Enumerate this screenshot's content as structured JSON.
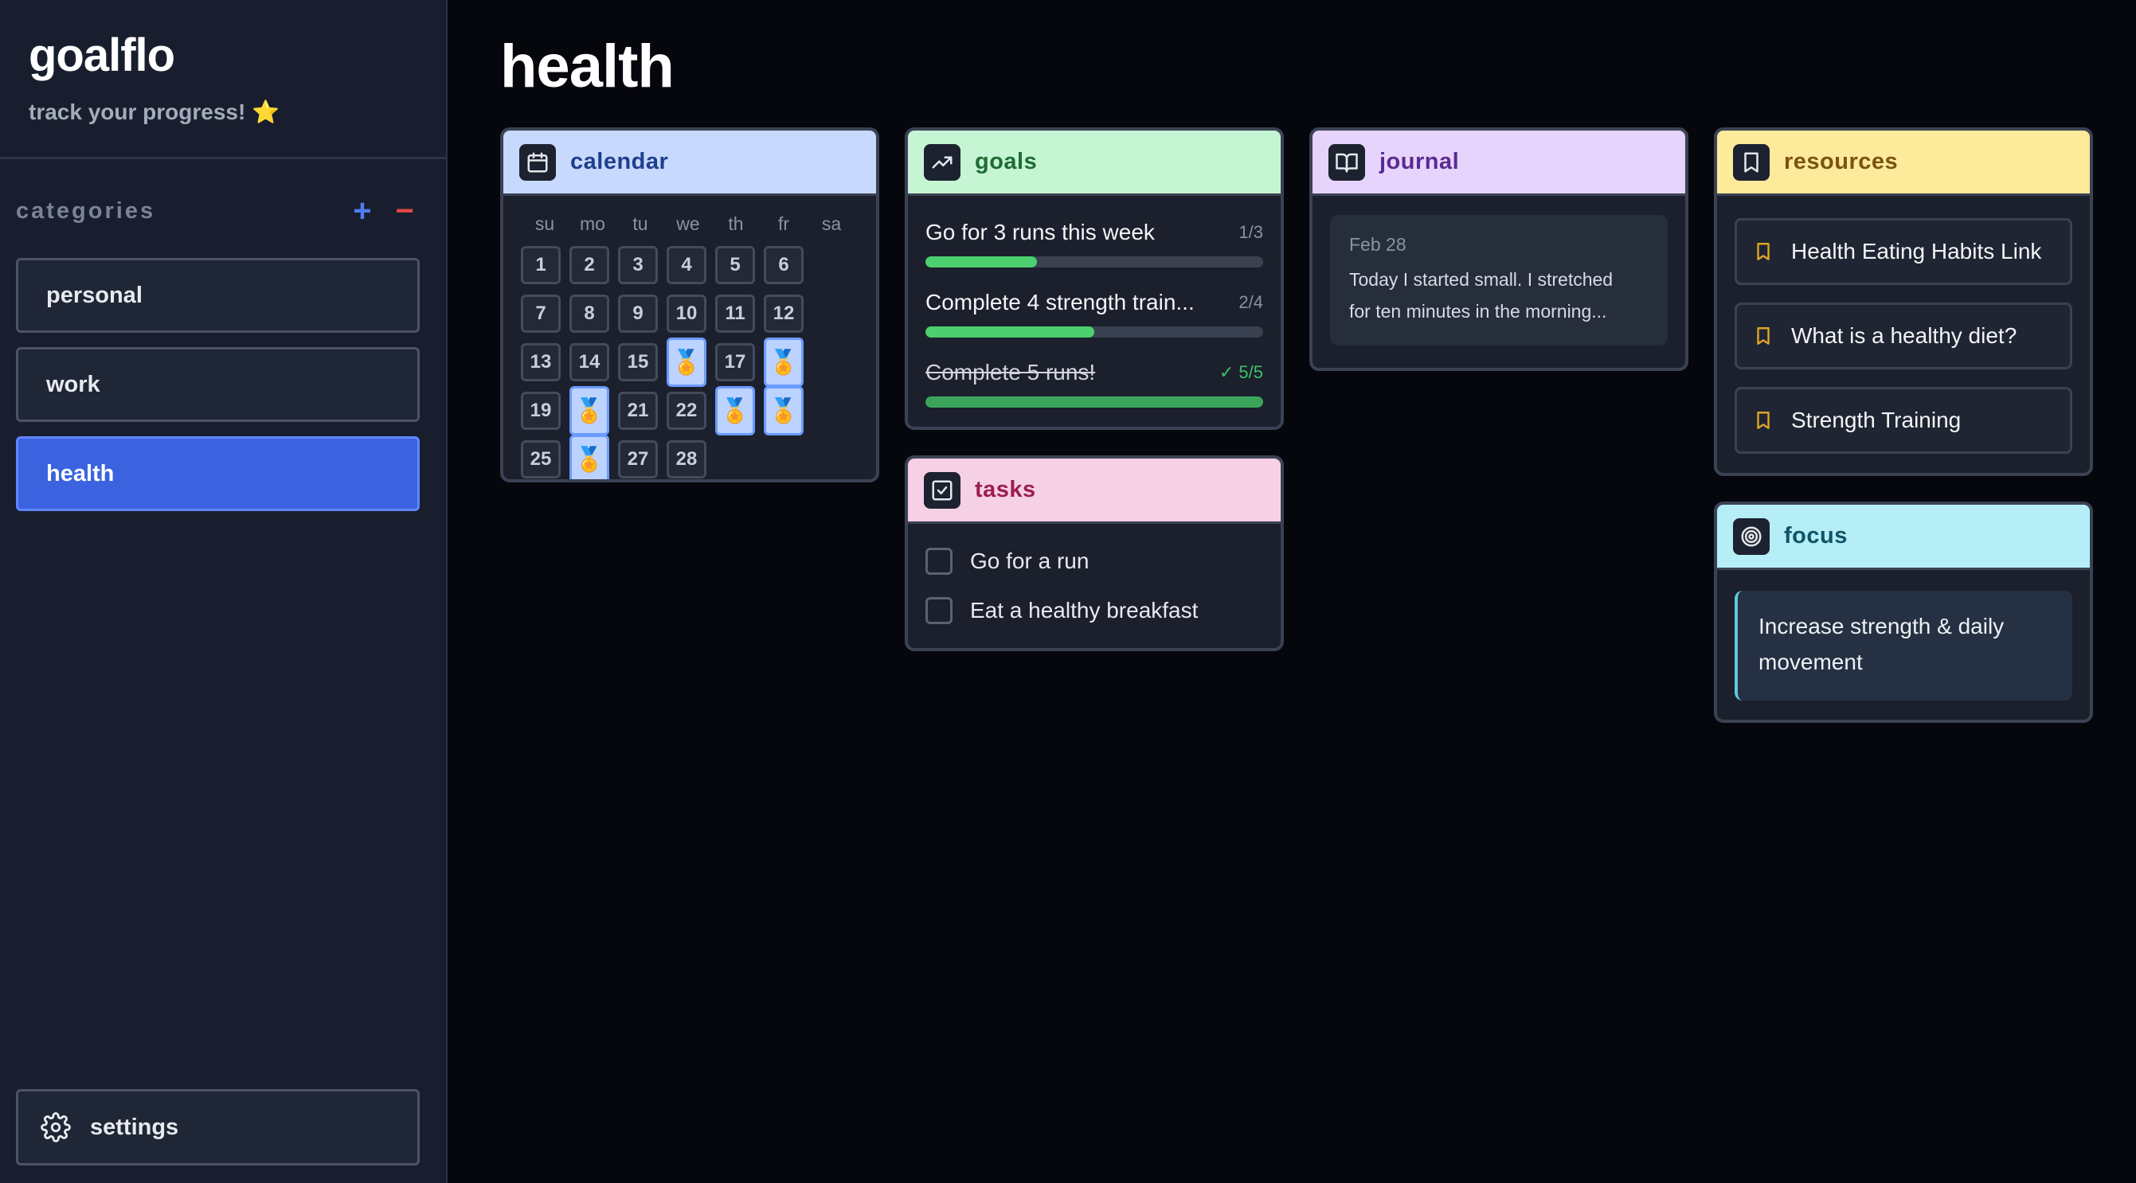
{
  "app": {
    "title": "goalflo",
    "subtitle": "track your progress!",
    "subtitle_emoji": "⭐"
  },
  "sidebar": {
    "categories_label": "categories",
    "add_symbol": "+",
    "remove_symbol": "−",
    "items": [
      {
        "label": "personal",
        "active": false
      },
      {
        "label": "work",
        "active": false
      },
      {
        "label": "health",
        "active": true
      }
    ],
    "settings_label": "settings"
  },
  "page": {
    "title": "health"
  },
  "colors": {
    "calendar": "#c7d9fc",
    "goals": "#c6f5d3",
    "journal": "#e6d4fc",
    "resources": "#fdea9a",
    "tasks": "#f6d0e5",
    "focus": "#b6eef8",
    "accent": "#3b63df"
  },
  "calendar": {
    "title": "calendar",
    "weekdays": [
      "su",
      "mo",
      "tu",
      "we",
      "th",
      "fr",
      "sa"
    ],
    "days": [
      "1",
      "2",
      "3",
      "4",
      "5",
      "6",
      "7",
      "8",
      "9",
      "10",
      "11",
      "12",
      "13",
      "14",
      "15",
      "16",
      "17",
      "18",
      "19",
      "20",
      "21",
      "22",
      "23",
      "24",
      "25",
      "26",
      "27",
      "28"
    ],
    "medal_days": [
      "16",
      "18",
      "20",
      "23",
      "24",
      "26"
    ],
    "medal_glyph": "🏅"
  },
  "goals": {
    "title": "goals",
    "items": [
      {
        "name": "Go for 3 runs this week",
        "count": "1/3",
        "progress": 0.33,
        "done": false
      },
      {
        "name": "Complete 4 strength train...",
        "count": "2/4",
        "progress": 0.5,
        "done": false
      },
      {
        "name": "Complete 5 runs!",
        "count": "✓ 5/5",
        "progress": 1.0,
        "done": true
      }
    ]
  },
  "tasks": {
    "title": "tasks",
    "items": [
      {
        "label": "Go for a run",
        "checked": false
      },
      {
        "label": "Eat a healthy breakfast",
        "checked": false
      }
    ]
  },
  "journal": {
    "title": "journal",
    "entry": {
      "date": "Feb 28",
      "line1": "Today I started small. I stretched",
      "line2": "for ten minutes in the morning..."
    }
  },
  "resources": {
    "title": "resources",
    "items": [
      "Health Eating Habits Link",
      "What is a healthy diet?",
      "Strength Training"
    ]
  },
  "focus": {
    "title": "focus",
    "line1": "Increase strength & daily",
    "line2": "movement"
  }
}
